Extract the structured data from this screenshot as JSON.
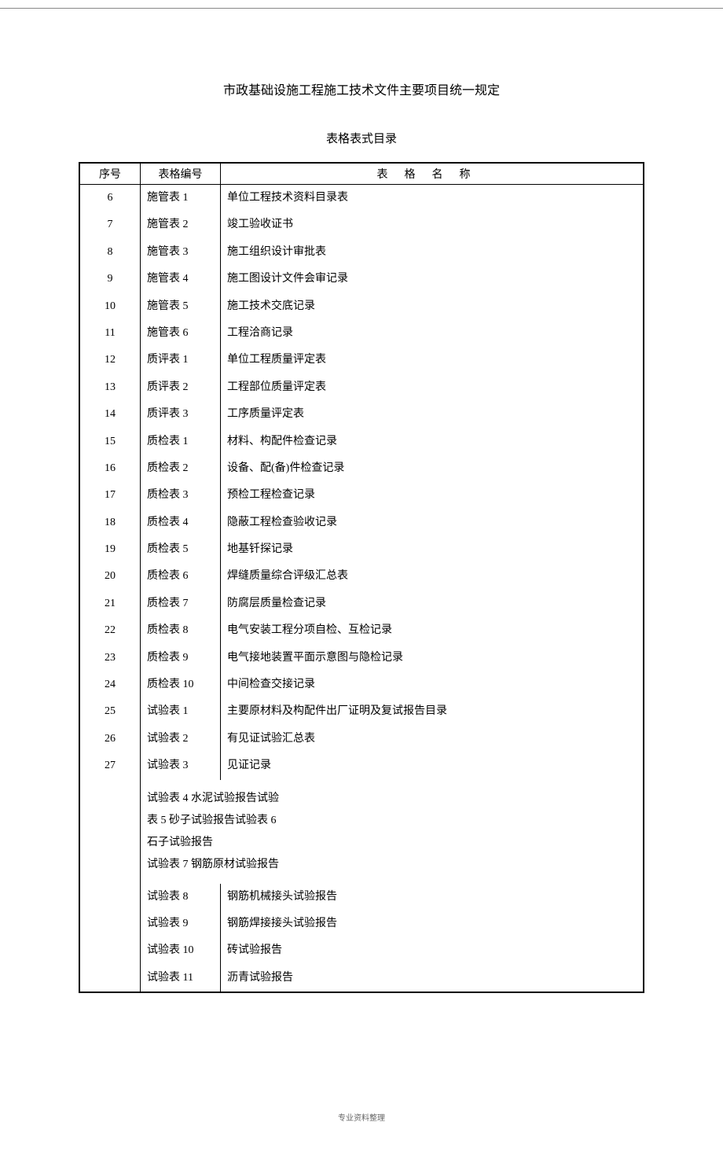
{
  "top_mark": "",
  "title": "市政基础设施工程施工技术文件主要项目统一规定",
  "subtitle": "表格表式目录",
  "headers": {
    "seq": "序号",
    "code": "表格编号",
    "name": "表格名称"
  },
  "rows": [
    {
      "seq": "6",
      "code": "施管表 1",
      "name": "单位工程技术资料目录表"
    },
    {
      "seq": "7",
      "code": "施管表 2",
      "name": "竣工验收证书"
    },
    {
      "seq": "8",
      "code": "施管表 3",
      "name": "施工组织设计审批表"
    },
    {
      "seq": "9",
      "code": "施管表 4",
      "name": "施工图设计文件会审记录"
    },
    {
      "seq": "10",
      "code": "施管表 5",
      "name": "施工技术交底记录"
    },
    {
      "seq": "11",
      "code": "施管表 6",
      "name": "工程洽商记录"
    },
    {
      "seq": "12",
      "code": "质评表 1",
      "name": "单位工程质量评定表"
    },
    {
      "seq": "13",
      "code": "质评表 2",
      "name": "工程部位质量评定表"
    },
    {
      "seq": "14",
      "code": "质评表 3",
      "name": "工序质量评定表"
    },
    {
      "seq": "15",
      "code": "质检表 1",
      "name": "材料、构配件检查记录"
    },
    {
      "seq": "16",
      "code": "质检表 2",
      "name": "设备、配(备)件检查记录"
    },
    {
      "seq": "17",
      "code": "质检表 3",
      "name": "预检工程检查记录"
    },
    {
      "seq": "18",
      "code": "质检表 4",
      "name": "隐蔽工程检查验收记录"
    },
    {
      "seq": "19",
      "code": "质检表 5",
      "name": "地基钎探记录"
    },
    {
      "seq": "20",
      "code": "质检表 6",
      "name": "焊缝质量综合评级汇总表"
    },
    {
      "seq": "21",
      "code": "质检表 7",
      "name": "防腐层质量检查记录"
    },
    {
      "seq": "22",
      "code": "质检表 8",
      "name": "电气安装工程分项自检、互检记录"
    },
    {
      "seq": "23",
      "code": "质检表 9",
      "name": "电气接地装置平面示意图与隐检记录"
    },
    {
      "seq": "24",
      "code": "质检表 10",
      "name": "中间检查交接记录"
    },
    {
      "seq": "25",
      "code": "试验表 1",
      "name": "主要原材料及构配件出厂证明及复试报告目录"
    },
    {
      "seq": "26",
      "code": "试验表 2",
      "name": "有见证试验汇总表"
    },
    {
      "seq": "27",
      "code": "试验表 3",
      "name": "见证记录"
    }
  ],
  "extra_block": {
    "line1": "试验表 4 水泥试验报告试验",
    "line2": "表 5 砂子试验报告试验表 6",
    "line3": "石子试验报告",
    "line4": "试验表 7 钢筋原材试验报告"
  },
  "rows2": [
    {
      "code": "试验表 8",
      "name": "钢筋机械接头试验报告"
    },
    {
      "code": "试验表 9",
      "name": "钢筋焊接接头试验报告"
    },
    {
      "code": "试验表 10",
      "name": "砖试验报告"
    },
    {
      "code": "试验表 11",
      "name": "沥青试验报告"
    }
  ],
  "footer": "专业资料整理"
}
